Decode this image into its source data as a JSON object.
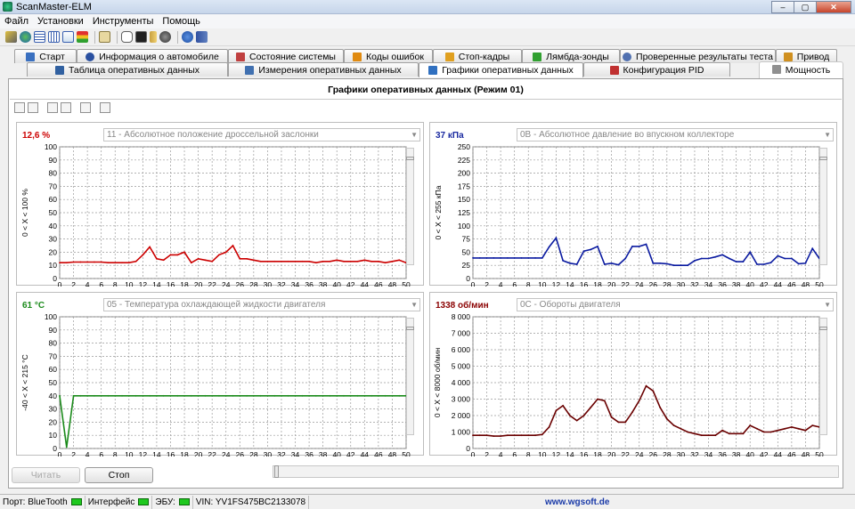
{
  "window": {
    "title": "ScanMaster-ELM",
    "min": "–",
    "max": "▢",
    "close": "✕"
  },
  "menu": [
    "Файл",
    "Установки",
    "Инструменты",
    "Помощь"
  ],
  "toolbar_icons": [
    "wrench-icon",
    "globe-icon",
    "table-icon",
    "grid-icon",
    "chart-icon",
    "flag-icon",
    "clipboard-icon",
    "chat-icon",
    "monitor-icon",
    "battery-icon",
    "gauge-icon",
    "info-icon",
    "book-icon"
  ],
  "tabs_row1": [
    {
      "label": "Старт",
      "icon_color": "#3a70c0"
    },
    {
      "label": "Информация о автомобиле",
      "icon_color": "#2a50a0"
    },
    {
      "label": "Состояние системы",
      "icon_color": "#c04040"
    },
    {
      "label": "Коды ошибок",
      "icon_color": "#e08a10"
    },
    {
      "label": "Стоп-кадры",
      "icon_color": "#e0a020"
    },
    {
      "label": "Лямбда-зонды",
      "icon_color": "#30a030"
    },
    {
      "label": "Проверенные результаты теста",
      "icon_color": "#5070b0"
    },
    {
      "label": "Привод",
      "icon_color": "#d09020"
    }
  ],
  "tabs_row2": [
    {
      "label": "Таблица оперативных данных",
      "icon_color": "#3060a0"
    },
    {
      "label": "Измерения оперативных данных",
      "icon_color": "#4070b0"
    },
    {
      "label": "Графики оперативных данных",
      "icon_color": "#3070c0",
      "active": true
    },
    {
      "label": "Конфигурация PID",
      "icon_color": "#c03030"
    },
    {
      "label": "Мощность",
      "icon_color": "#909090"
    }
  ],
  "page_title": "Графики оперативных данных (Режим 01)",
  "sub_toolbar_icons": [
    "add-graph-icon",
    "remove-graph-icon",
    "open-icon",
    "save-icon",
    "print-preview-icon",
    "print-icon"
  ],
  "charts": [
    {
      "value": "12,6 %",
      "value_color": "#cc0000",
      "pid": "11 - Абсолютное положение дроссельной заслонки",
      "ylabel": "0  < X <  100  %",
      "ylim": [
        0,
        100
      ],
      "yticks": [
        0,
        10,
        20,
        30,
        40,
        50,
        60,
        70,
        80,
        90,
        100
      ],
      "line_color": "#cc0000",
      "slider_level": 0.93
    },
    {
      "value": "37 кПа",
      "value_color": "#1a2aa0",
      "pid": "0B - Абсолютное давление во впускном коллекторе",
      "ylabel": "0  < X <  255  кПа",
      "ylim": [
        0,
        250
      ],
      "yticks": [
        0,
        25,
        50,
        75,
        100,
        125,
        150,
        175,
        200,
        225,
        250
      ],
      "line_color": "#0a1aa0",
      "slider_level": 0.93
    },
    {
      "value": "61 °C",
      "value_color": "#1a8a1a",
      "pid": "05 - Температура охлаждающей жидкости двигателя",
      "ylabel": "-40  < X <  215  °C",
      "ylim": [
        0,
        100
      ],
      "yticks": [
        0,
        10,
        20,
        30,
        40,
        50,
        60,
        70,
        80,
        90,
        100
      ],
      "line_color": "#1a8a1a",
      "slider_level": 0.93
    },
    {
      "value": "1338 об/мин",
      "value_color": "#8a0000",
      "pid": "0C - Обороты двигателя",
      "ylabel": "0  < X <  8000  об/мин",
      "ylim": [
        0,
        8000
      ],
      "yticks": [
        0,
        1000,
        2000,
        3000,
        4000,
        5000,
        6000,
        7000,
        8000
      ],
      "line_color": "#6a0000",
      "slider_level": 0.93
    }
  ],
  "chart_data": [
    {
      "type": "line",
      "x": [
        0,
        1,
        2,
        3,
        4,
        5,
        6,
        7,
        8,
        9,
        10,
        11,
        12,
        13,
        14,
        15,
        16,
        17,
        18,
        19,
        20,
        21,
        22,
        23,
        24,
        25,
        26,
        27,
        28,
        29,
        30,
        31,
        32,
        33,
        34,
        35,
        36,
        37,
        38,
        39,
        40,
        41,
        42,
        43,
        44,
        45,
        46,
        47,
        48,
        49,
        50
      ],
      "series": [
        {
          "values": [
            12,
            12,
            12.5,
            12.5,
            12.5,
            12.5,
            12.5,
            12,
            12,
            12,
            12,
            13,
            18,
            24,
            15,
            14,
            18,
            18,
            20,
            12,
            15,
            14,
            13,
            18,
            20,
            25,
            15,
            15,
            14,
            13,
            13,
            13,
            13,
            13,
            13,
            13,
            13,
            12,
            13,
            13,
            14,
            13,
            13,
            13,
            14,
            13,
            13,
            12,
            13,
            14,
            12
          ]
        }
      ],
      "ylabel": "0  < X <  100  %",
      "xlim": [
        0,
        50
      ],
      "ylim": [
        0,
        100
      ]
    },
    {
      "type": "line",
      "x": [
        0,
        1,
        2,
        3,
        4,
        5,
        6,
        7,
        8,
        9,
        10,
        11,
        12,
        13,
        14,
        15,
        16,
        17,
        18,
        19,
        20,
        21,
        22,
        23,
        24,
        25,
        26,
        27,
        28,
        29,
        30,
        31,
        32,
        33,
        34,
        35,
        36,
        37,
        38,
        39,
        40,
        41,
        42,
        43,
        44,
        45,
        46,
        47,
        48,
        49,
        50
      ],
      "series": [
        {
          "values": [
            39,
            39,
            39,
            39,
            39,
            39,
            39,
            39,
            39,
            39,
            39,
            60,
            77,
            34,
            29,
            27,
            52,
            55,
            61,
            27,
            29,
            26,
            38,
            61,
            61,
            65,
            29,
            29,
            28,
            25,
            25,
            25,
            34,
            38,
            38,
            41,
            45,
            38,
            32,
            32,
            50,
            27,
            27,
            30,
            43,
            38,
            38,
            28,
            29,
            57,
            38
          ]
        }
      ],
      "ylabel": "0  < X <  255  кПа",
      "xlim": [
        0,
        50
      ],
      "ylim": [
        0,
        250
      ]
    },
    {
      "type": "line",
      "x": [
        0,
        1,
        2,
        3,
        4,
        5,
        6,
        7,
        8,
        9,
        10,
        11,
        12,
        13,
        14,
        15,
        16,
        17,
        18,
        19,
        20,
        21,
        22,
        23,
        24,
        25,
        26,
        27,
        28,
        29,
        30,
        31,
        32,
        33,
        34,
        35,
        36,
        37,
        38,
        39,
        40,
        41,
        42,
        43,
        44,
        45,
        46,
        47,
        48,
        49,
        50
      ],
      "series": [
        {
          "values": [
            40,
            1,
            40,
            40,
            40,
            40,
            40,
            40,
            40,
            40,
            40,
            40,
            40,
            40,
            40,
            40,
            40,
            40,
            40,
            40,
            40,
            40,
            40,
            40,
            40,
            40,
            40,
            40,
            40,
            40,
            40,
            40,
            40,
            40,
            40,
            40,
            40,
            40,
            40,
            40,
            40,
            40,
            40,
            40,
            40,
            40,
            40,
            40,
            40,
            40,
            40
          ]
        }
      ],
      "ylabel": "-40  < X <  215  °C",
      "xlim": [
        0,
        50
      ],
      "ylim": [
        0,
        100
      ]
    },
    {
      "type": "line",
      "x": [
        0,
        1,
        2,
        3,
        4,
        5,
        6,
        7,
        8,
        9,
        10,
        11,
        12,
        13,
        14,
        15,
        16,
        17,
        18,
        19,
        20,
        21,
        22,
        23,
        24,
        25,
        26,
        27,
        28,
        29,
        30,
        31,
        32,
        33,
        34,
        35,
        36,
        37,
        38,
        39,
        40,
        41,
        42,
        43,
        44,
        45,
        46,
        47,
        48,
        49,
        50
      ],
      "series": [
        {
          "values": [
            800,
            800,
            800,
            750,
            750,
            800,
            800,
            800,
            800,
            800,
            850,
            1300,
            2300,
            2600,
            2000,
            1700,
            2000,
            2500,
            3000,
            2900,
            1900,
            1600,
            1600,
            2200,
            2900,
            3800,
            3500,
            2500,
            1800,
            1400,
            1200,
            1000,
            900,
            800,
            800,
            800,
            1100,
            900,
            900,
            900,
            1400,
            1200,
            1000,
            1000,
            1100,
            1200,
            1300,
            1200,
            1100,
            1400,
            1300
          ]
        }
      ],
      "ylabel": "0  < X <  8000  об/мин",
      "xlim": [
        0,
        50
      ],
      "ylim": [
        0,
        8000
      ]
    }
  ],
  "xticks": [
    0,
    2,
    4,
    6,
    8,
    10,
    12,
    14,
    16,
    18,
    20,
    22,
    24,
    26,
    28,
    30,
    32,
    34,
    36,
    38,
    40,
    42,
    44,
    46,
    48,
    50
  ],
  "buttons": {
    "read": "Читать",
    "stop": "Стоп"
  },
  "status": {
    "port": "Порт: BlueTooth",
    "interface": "Интерфейс",
    "ecu": "ЭБУ:",
    "vin": "VIN: YV1FS475BC2133078",
    "link": "www.wgsoft.de"
  }
}
